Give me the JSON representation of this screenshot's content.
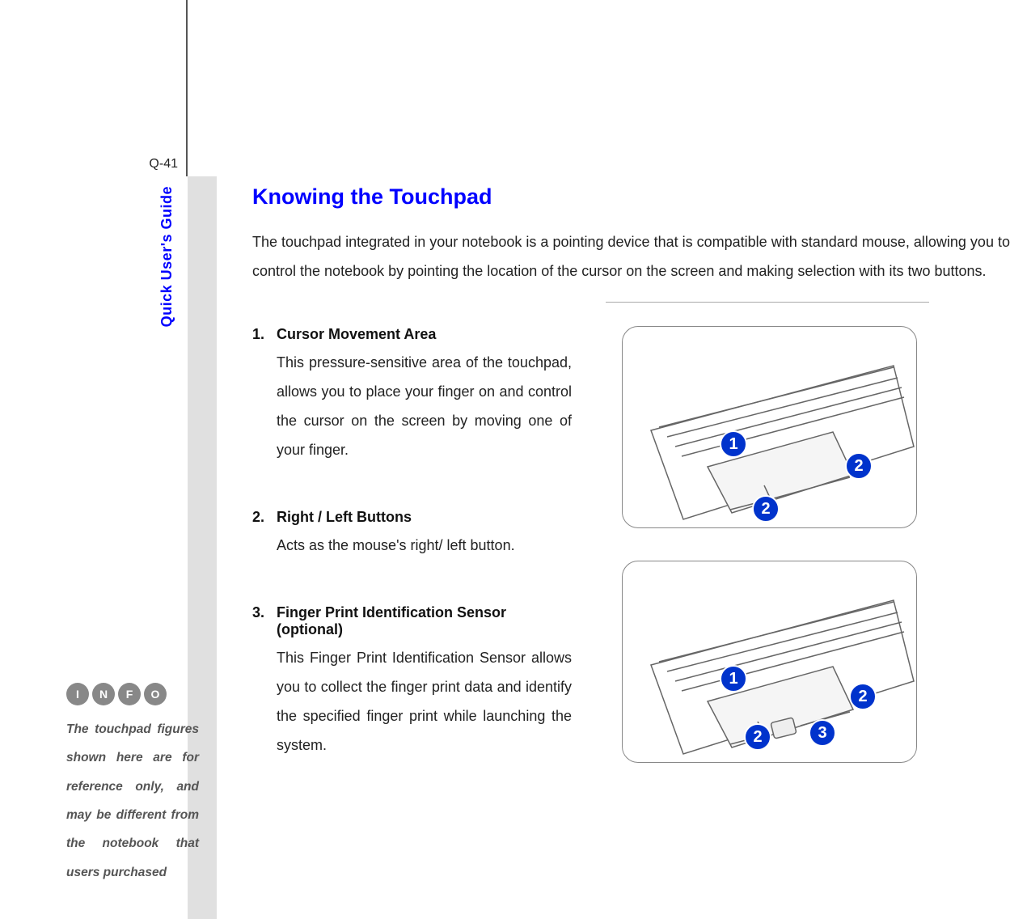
{
  "page_number": "Q-41",
  "vertical_header": "Quick User's Guide",
  "note_icons_letters": "INFO",
  "sidebar_note": "The touchpad figures shown here are for reference only, and may be different from the notebook that users purchased",
  "title": "Knowing the Touchpad",
  "intro": "The touchpad integrated in your notebook is a pointing device that is compatible with standard mouse, allowing you to control the notebook by pointing the location of the cursor on the screen and making selection with its two buttons.",
  "items": [
    {
      "num": "1.",
      "title": "Cursor Movement Area",
      "body": "This pressure-sensitive area of the touchpad, allows you to place your finger on and control the cursor on the screen by moving one of your finger."
    },
    {
      "num": "2.",
      "title": "Right / Left Buttons",
      "body": "Acts as the mouse's right/ left button."
    },
    {
      "num": "3.",
      "title": "Finger Print Identification Sensor (optional)",
      "body": "This Finger Print Identification Sensor allows you to collect the finger print data and identify the specified finger print while launching the system."
    }
  ],
  "figure1_badges": [
    "1",
    "2",
    "2"
  ],
  "figure2_badges": [
    "1",
    "2",
    "2",
    "3"
  ]
}
